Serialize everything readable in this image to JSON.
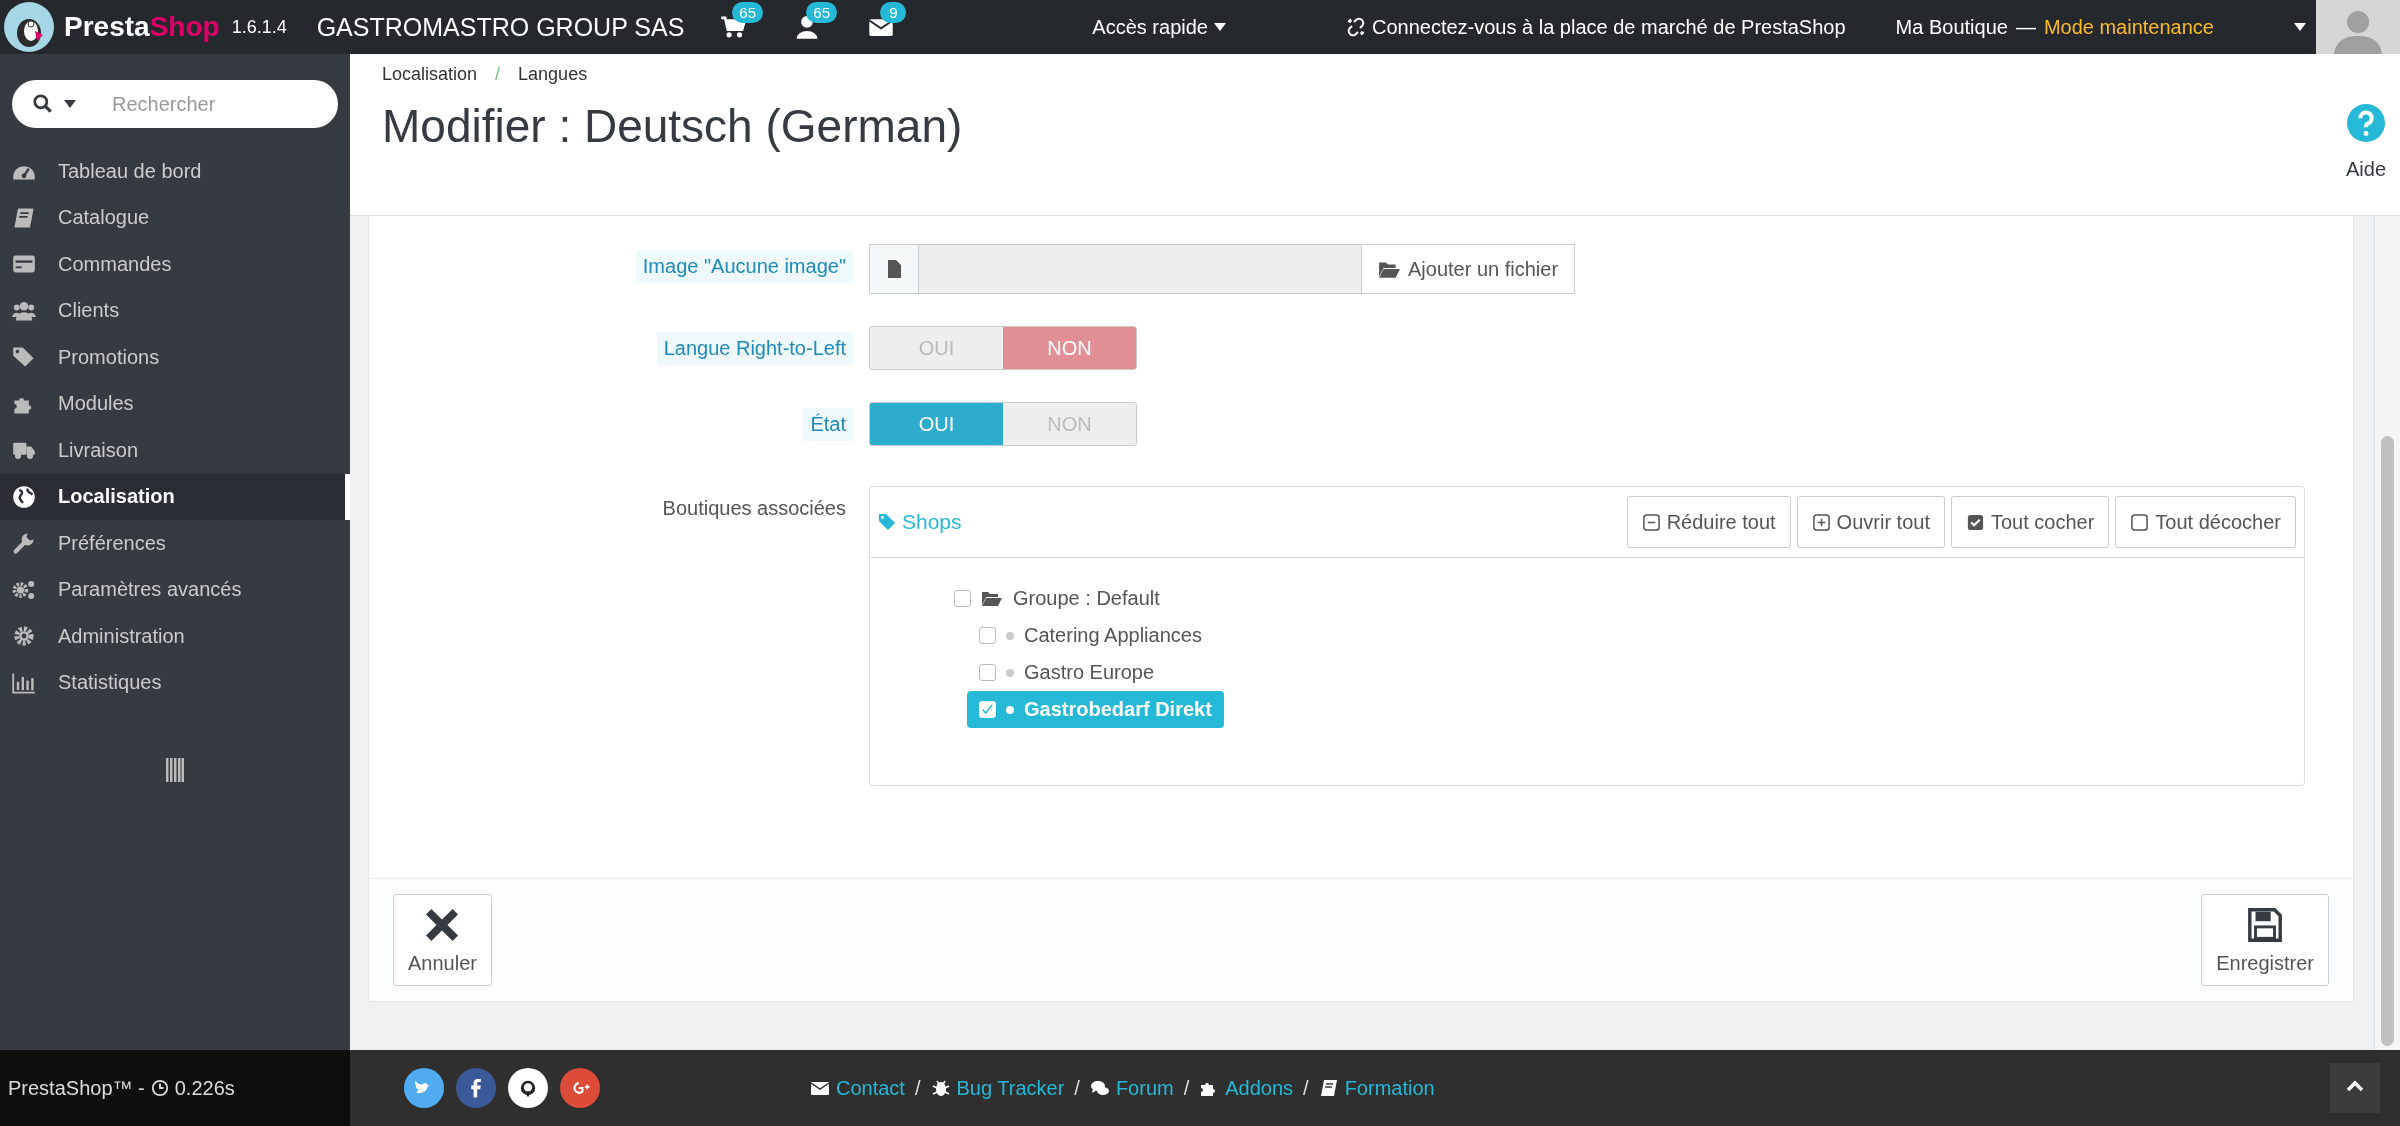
{
  "topbar": {
    "brand_first": "Presta",
    "brand_second": "Shop",
    "version": "1.6.1.4",
    "shop_name": "GASTROMASTRO GROUP SAS",
    "notifications": [
      {
        "kind": "cart",
        "count": "65"
      },
      {
        "kind": "customer",
        "count": "65"
      },
      {
        "kind": "message",
        "count": "9"
      }
    ],
    "quick_access": "Accès rapide",
    "marketplace": "Connectez-vous à la place de marché de PrestaShop",
    "shop": "Ma Boutique",
    "shop_separator": "—",
    "mode": "Mode maintenance"
  },
  "sidebar": {
    "search": {
      "placeholder": "Rechercher"
    },
    "items": [
      {
        "label": "Tableau de bord",
        "kind": "dashboard",
        "selected": false
      },
      {
        "label": "Catalogue",
        "kind": "book",
        "selected": false
      },
      {
        "label": "Commandes",
        "kind": "card",
        "selected": false
      },
      {
        "label": "Clients",
        "kind": "users",
        "selected": false
      },
      {
        "label": "Promotions",
        "kind": "tags",
        "selected": false
      },
      {
        "label": "Modules",
        "kind": "puzzle",
        "selected": false
      },
      {
        "label": "Livraison",
        "kind": "truck",
        "selected": false
      },
      {
        "label": "Localisation",
        "kind": "globe",
        "selected": true
      },
      {
        "label": "Préférences",
        "kind": "wrench",
        "selected": false
      },
      {
        "label": "Paramètres avancés",
        "kind": "gears",
        "selected": false
      },
      {
        "label": "Administration",
        "kind": "gear",
        "selected": false
      },
      {
        "label": "Statistiques",
        "kind": "chart",
        "selected": false
      }
    ]
  },
  "header": {
    "breadcrumb": [
      {
        "label": "Localisation",
        "separator": "/"
      },
      {
        "label": "Langues"
      }
    ],
    "title": "Modifier : Deutsch (German)",
    "help": "Aide"
  },
  "form": {
    "fields": [
      {
        "kind": "file",
        "label": "Image \"Aucune image\"",
        "button": "Ajouter un fichier"
      },
      {
        "kind": "switch",
        "label": "Langue Right-to-Left",
        "options": [
          {
            "label": "OUI",
            "selected": false
          },
          {
            "label": "NON",
            "selected": true
          }
        ]
      },
      {
        "kind": "switch",
        "label": "État",
        "options": [
          {
            "label": "OUI",
            "selected": true
          },
          {
            "label": "NON",
            "selected": false
          }
        ]
      },
      {
        "kind": "tree",
        "label": "Boutiques associées",
        "tree": {
          "title": "Shops",
          "buttons": [
            {
              "label": "Réduire tout",
              "kind": "minus"
            },
            {
              "label": "Ouvrir tout",
              "kind": "plus"
            },
            {
              "label": "Tout cocher",
              "kind": "checked"
            },
            {
              "label": "Tout décocher",
              "kind": "unchecked"
            }
          ],
          "nodes": [
            {
              "label": "Groupe : Default",
              "checked": false,
              "expanded": true,
              "children": [
                {
                  "label": "Catering Appliances",
                  "checked": false
                },
                {
                  "label": "Gastro Europe",
                  "checked": false
                },
                {
                  "label": "Gastrobedarf Direkt",
                  "checked": true
                }
              ]
            }
          ]
        }
      }
    ],
    "actions": [
      {
        "label": "Annuler",
        "kind": "cancel"
      },
      {
        "label": "Enregistrer",
        "kind": "save"
      }
    ]
  },
  "footer": {
    "brand": "PrestaShop™ -",
    "time": "0.226s",
    "socials": [
      {
        "kind": "twitter",
        "color": "#50abf1"
      },
      {
        "kind": "facebook",
        "color": "#3b5998"
      },
      {
        "kind": "github",
        "color": "#ffffff"
      },
      {
        "kind": "google",
        "color": "#dd4b39"
      }
    ],
    "links": [
      {
        "label": "Contact",
        "kind": "envelope",
        "separator": "/"
      },
      {
        "label": "Bug Tracker",
        "kind": "bug",
        "separator": "/"
      },
      {
        "label": "Forum",
        "kind": "comments",
        "separator": "/"
      },
      {
        "label": "Addons",
        "kind": "puzzle",
        "separator": "/"
      },
      {
        "label": "Formation",
        "kind": "book"
      }
    ]
  }
}
